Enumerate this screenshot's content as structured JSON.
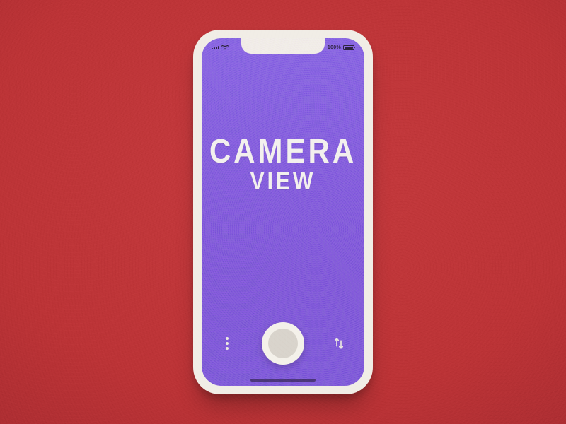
{
  "colors": {
    "background": "#bd3437",
    "phone_body": "#f1ede6",
    "screen_purple": "#8663da",
    "text_light": "#f3f0ee"
  },
  "status": {
    "battery_percent": "100%"
  },
  "screen": {
    "title_line1": "CAMERA",
    "title_line2": "VIEW"
  },
  "icons": {
    "more": "more-vertical-icon",
    "shutter": "shutter-icon",
    "swap": "swap-vertical-icon",
    "wifi": "wifi-icon",
    "signal": "cellular-signal-icon",
    "battery": "battery-icon"
  }
}
